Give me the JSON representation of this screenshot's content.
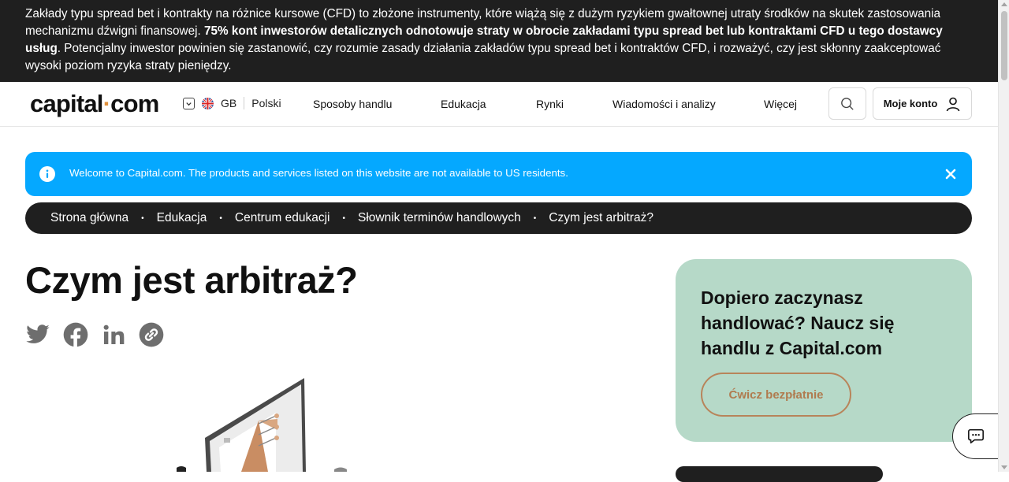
{
  "risk_warning": {
    "text_before": "Zakłady typu spread bet i kontrakty na różnice kursowe (CFD) to złożone instrumenty, które wiążą się z dużym ryzykiem gwałtownej utraty środków na skutek zastosowania mechanizmu dźwigni finansowej. ",
    "text_bold": "75% kont inwestorów detalicznych odnotowuje straty w obrocie zakładami typu spread bet lub kontraktami CFD u tego dostawcy usług",
    "text_after": ". Potencjalny inwestor powinien się zastanowić, czy rozumie zasady działania zakładów typu spread bet i kontraktów CFD, i rozważyć, czy jest skłonny zaakceptować wysoki poziom ryzyka straty pieniędzy."
  },
  "header": {
    "logo_left": "capital",
    "logo_dot": "·",
    "logo_right": "com",
    "country": "GB",
    "language": "Polski",
    "nav": [
      "Sposoby handlu",
      "Edukacja",
      "Rynki",
      "Wiadomości i analizy",
      "Więcej"
    ],
    "account_label": "Moje konto"
  },
  "notice": {
    "text": "Welcome to Capital.com. The products and services listed on this website are not available to US residents."
  },
  "breadcrumb": [
    "Strona główna",
    "Edukacja",
    "Centrum edukacji",
    "Słownik terminów handlowych",
    "Czym jest arbitraż?"
  ],
  "breadcrumb_separator": "•",
  "article": {
    "title": "Czym jest arbitraż?"
  },
  "share_icons": [
    "twitter-icon",
    "facebook-icon",
    "linkedin-icon",
    "copy-link-icon"
  ],
  "promo": {
    "heading": "Dopiero zaczynasz handlować? Naucz się handlu z Capital.com",
    "cta_label": "Ćwicz bezpłatnie"
  },
  "colors": {
    "risk_bar_bg": "#1f1f1f",
    "notice_bg": "#05a8ff",
    "promo_bg": "#b6d9c8",
    "cta_border": "#b8845a",
    "brand_accent": "#e0913c"
  }
}
